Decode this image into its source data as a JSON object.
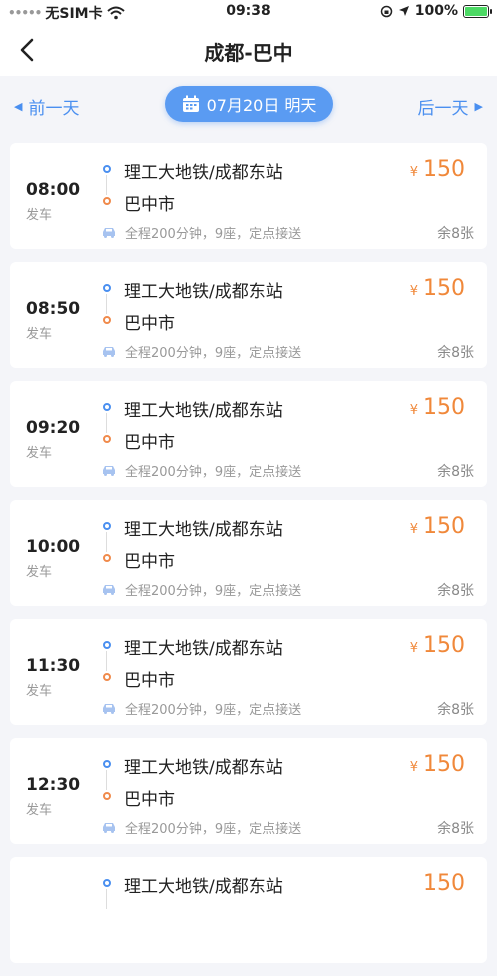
{
  "status_bar": {
    "signal_dots": "•••••",
    "carrier": "无SIM卡",
    "time": "09:38",
    "battery_percent": "100%"
  },
  "nav": {
    "title": "成都-巴中"
  },
  "date_bar": {
    "prev_label": "前一天",
    "date_label": "07月20日 明天",
    "next_label": "后一天"
  },
  "trips": [
    {
      "time": "08:00",
      "depart_label": "发车",
      "from": "理工大地铁/成都东站",
      "to": "巴中市",
      "currency": "¥",
      "price": "150",
      "info": "全程200分钟，9座，定点接送",
      "seats": "余8张"
    },
    {
      "time": "08:50",
      "depart_label": "发车",
      "from": "理工大地铁/成都东站",
      "to": "巴中市",
      "currency": "¥",
      "price": "150",
      "info": "全程200分钟，9座，定点接送",
      "seats": "余8张"
    },
    {
      "time": "09:20",
      "depart_label": "发车",
      "from": "理工大地铁/成都东站",
      "to": "巴中市",
      "currency": "¥",
      "price": "150",
      "info": "全程200分钟，9座，定点接送",
      "seats": "余8张"
    },
    {
      "time": "10:00",
      "depart_label": "发车",
      "from": "理工大地铁/成都东站",
      "to": "巴中市",
      "currency": "¥",
      "price": "150",
      "info": "全程200分钟，9座，定点接送",
      "seats": "余8张"
    },
    {
      "time": "11:30",
      "depart_label": "发车",
      "from": "理工大地铁/成都东站",
      "to": "巴中市",
      "currency": "¥",
      "price": "150",
      "info": "全程200分钟，9座，定点接送",
      "seats": "余8张"
    },
    {
      "time": "12:30",
      "depart_label": "发车",
      "from": "理工大地铁/成都东站",
      "to": "巴中市",
      "currency": "¥",
      "price": "150",
      "info": "全程200分钟，9座，定点接送",
      "seats": "余8张"
    },
    {
      "time": "",
      "depart_label": "",
      "from": "理工大地铁/成都东站",
      "to": "",
      "currency": "",
      "price": "150",
      "info": "",
      "seats": ""
    }
  ],
  "colors": {
    "accent": "#4a8ff0",
    "price": "#f0883a",
    "start_dot": "#4a8ff0",
    "end_dot": "#f08a4b"
  }
}
